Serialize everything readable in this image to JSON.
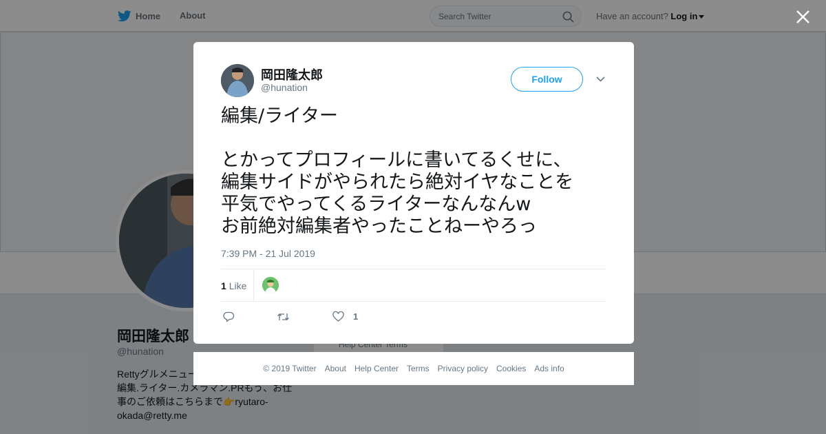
{
  "topbar": {
    "home": "Home",
    "about": "About",
    "search_placeholder": "Search Twitter",
    "have_account": "Have an account?",
    "login": "Log in"
  },
  "background": {
    "name": "岡田隆太郎",
    "handle": "@hunation",
    "bio": "Rettyグルメニュー\n編集.ライター.カメラマン.PRもう、お仕事のご依頼はこちらまで👉ryutaro-okada@retty.me",
    "footer_links": "Help Center   Terms"
  },
  "tweet": {
    "name": "岡田隆太郎",
    "handle": "@hunation",
    "follow_label": "Follow",
    "text": "編集/ライター\n\nとかってプロフィールに書いてるくせに、\n編集サイドがやられたら絶対イヤなことを\n平気でやってくるライターなんなんw\nお前絶対編集者やったことねーやろっ",
    "timestamp": "7:39 PM - 21 Jul 2019",
    "like_count": "1",
    "like_label": "Like",
    "action_like_count": "1"
  },
  "footer": {
    "links": [
      "© 2019 Twitter",
      "About",
      "Help Center",
      "Terms",
      "Privacy policy",
      "Cookies",
      "Ads info"
    ]
  },
  "colors": {
    "brand": "#1da1f2",
    "text": "#14171a",
    "muted": "#657786"
  }
}
